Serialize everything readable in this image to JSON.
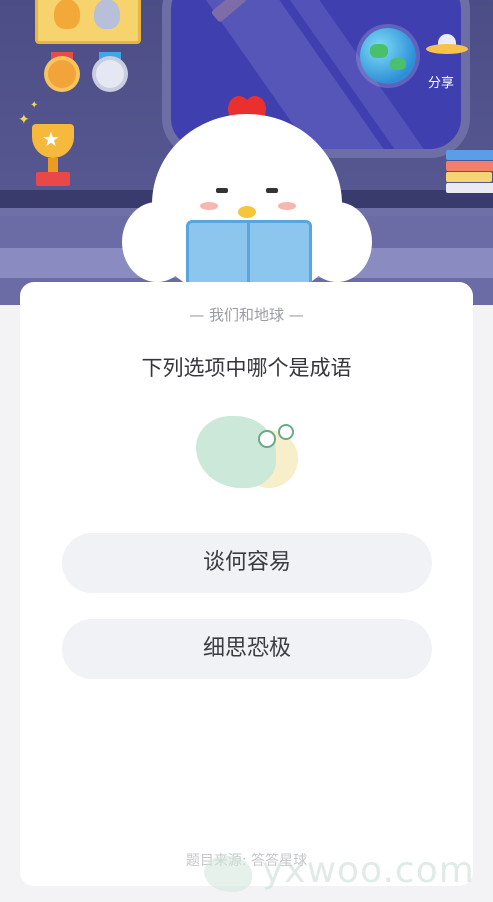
{
  "header": {
    "share_label": "分享"
  },
  "quiz": {
    "subtitle": "— 我们和地球 —",
    "question": "下列选项中哪个是成语",
    "options": [
      {
        "label": "谈何容易"
      },
      {
        "label": "细思恐极"
      }
    ],
    "source": "题目来源: 答答星球"
  },
  "watermark": {
    "text": "yxwoo.com"
  },
  "colors": {
    "scene_background": "#4c4d86",
    "card_background": "#ffffff",
    "option_background": "#f1f2f5",
    "question_text": "#34363c",
    "muted_text": "#9a9ca3"
  },
  "icons": [
    "medal-frame-icon",
    "gold-medal-icon",
    "silver-medal-icon",
    "trophy-icon",
    "earth-globe-icon",
    "ufo-icon",
    "books-icon",
    "chick-mascot",
    "snail-mascot"
  ]
}
